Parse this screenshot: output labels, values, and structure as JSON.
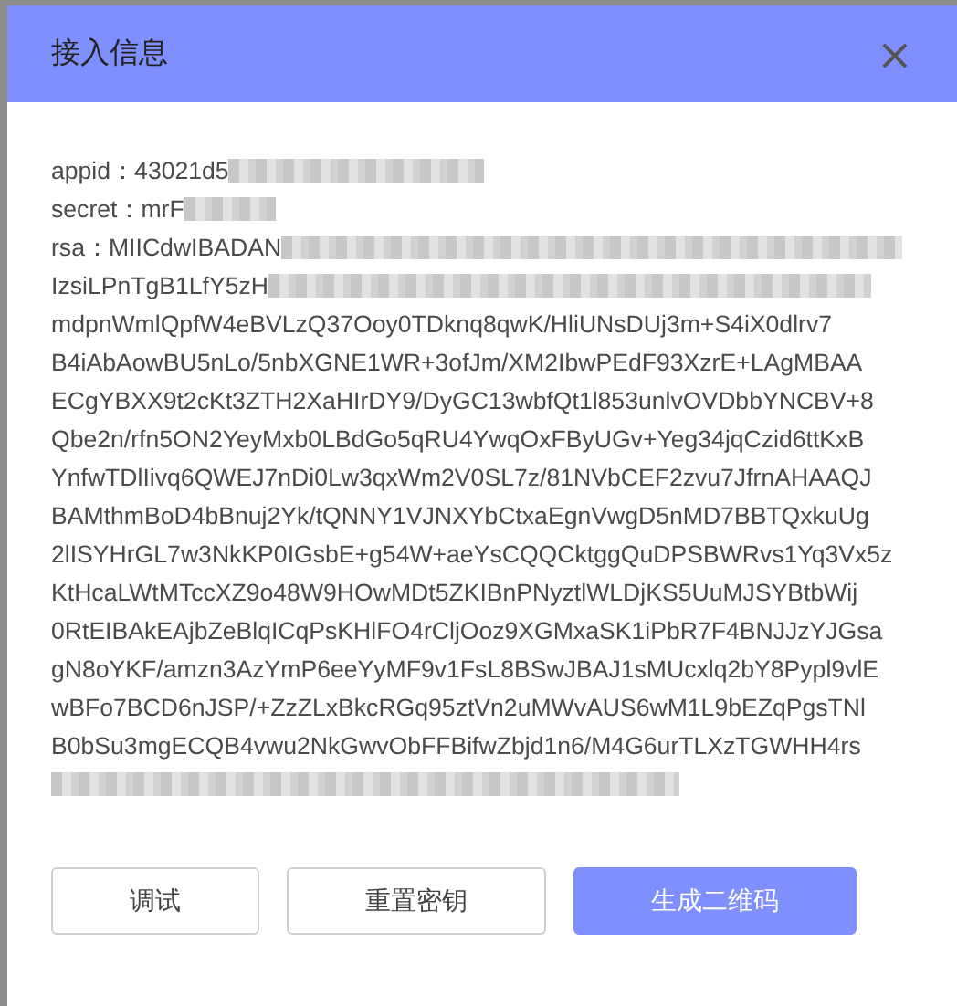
{
  "dialog": {
    "title": "接入信息",
    "close": "×",
    "fields": [
      {
        "label": "appid：",
        "value": "43021d5",
        "redacted": true
      },
      {
        "label": "secret：",
        "value": "mrF",
        "redacted": true
      }
    ],
    "rsa": {
      "label": "rsa：",
      "lines": [
        {
          "text": "MIICdwIBADAN",
          "redacted": true
        },
        {
          "text": "IzsiLPnTgB1LfY5zH",
          "redacted": true
        },
        {
          "text": "mdpnWmlQpfW4eBVLzQ37Ooy0TDknq8qwK/HliUNsDUj3m+S4iX0dlrv7",
          "redacted": false
        },
        {
          "text": "B4iAbAowBU5nLo/5nbXGNE1WR+3ofJm/XM2IbwPEdF93XzrE+LAgMBAA",
          "redacted": false
        },
        {
          "text": "ECgYBXX9t2cKt3ZTH2XaHIrDY9/DyGC13wbfQt1l853unlvOVDbbYNCBV+8",
          "redacted": false
        },
        {
          "text": "Qbe2n/rfn5ON2YeyMxb0LBdGo5qRU4YwqOxFByUGv+Yeg34jqCzid6ttKxB",
          "redacted": false
        },
        {
          "text": "YnfwTDlIivq6QWEJ7nDi0Lw3qxWm2V0SL7z/81NVbCEF2zvu7JfrnAHAAQJ",
          "redacted": false
        },
        {
          "text": "BAMthmBoD4bBnuj2Yk/tQNNY1VJNXYbCtxaEgnVwgD5nMD7BBTQxkuUg",
          "redacted": false
        },
        {
          "text": "2lISYHrGL7w3NkKP0IGsbE+g54W+aeYsCQQCktggQuDPSBWRvs1Yq3Vx5z",
          "redacted": false
        },
        {
          "text": "KtHcaLWtMTccXZ9o48W9HOwMDt5ZKIBnPNyztlWLDjKS5UuMJSYBtbWij",
          "redacted": false
        },
        {
          "text": "0RtEIBAkEAjbZeBlqICqPsKHlFO4rCljOoz9XGMxaSK1iPbR7F4BNJJzYJGsa",
          "redacted": false
        },
        {
          "text": "gN8oYKF/amzn3AzYmP6eeYyMF9v1FsL8BSwJBAJ1sMUcxlq2bY8Pypl9vlE",
          "redacted": false
        },
        {
          "text": "wBFo7BCD6nJSP/+ZzZLxBkcRGq95ztVn2uMWvAUS6wM1L9bEZqPgsTNl",
          "redacted": false
        },
        {
          "text": "B0bSu3mgECQB4vwu2NkGwvObFFBifwZbjd1n6/M4G6urTLXzTGWHH4rs",
          "redacted": false
        },
        {
          "redacted": true
        }
      ]
    },
    "buttons": [
      {
        "label": "调试",
        "kind": "default"
      },
      {
        "label": "重置密钥",
        "kind": "default"
      },
      {
        "label": "生成二维码",
        "kind": "primary"
      }
    ]
  }
}
